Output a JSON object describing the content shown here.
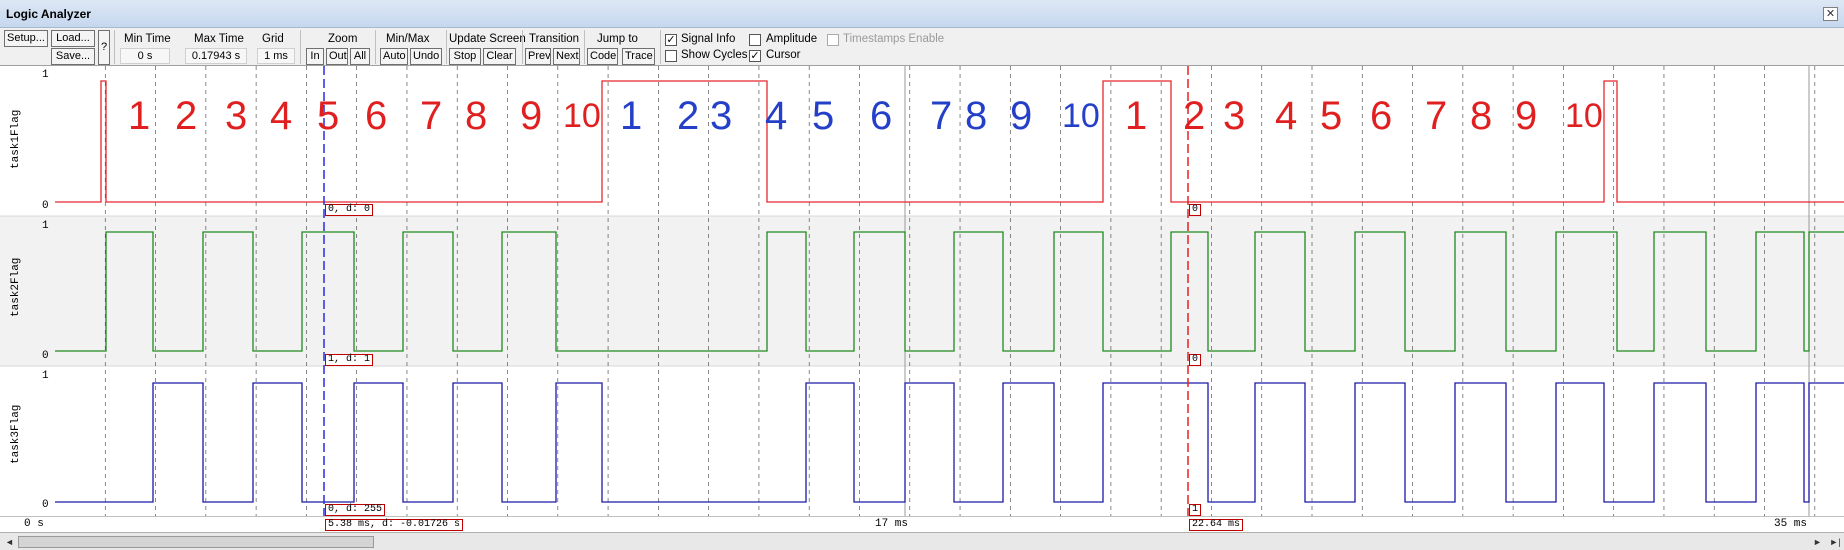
{
  "window": {
    "title": "Logic Analyzer",
    "close_glyph": "✕"
  },
  "toolbar": {
    "setup": "Setup...",
    "load": "Load...",
    "save": "Save...",
    "help": "?",
    "min_time_label": "Min Time",
    "min_time_value": "0 s",
    "max_time_label": "Max Time",
    "max_time_value": "0.17943 s",
    "grid_label": "Grid",
    "grid_value": "1 ms",
    "zoom_label": "Zoom",
    "zoom_in": "In",
    "zoom_out": "Out",
    "zoom_all": "All",
    "minmax_label": "Min/Max",
    "minmax_auto": "Auto",
    "minmax_undo": "Undo",
    "update_label": "Update Screen",
    "update_stop": "Stop",
    "update_clear": "Clear",
    "transition_label": "Transition",
    "transition_prev": "Prev",
    "transition_next": "Next",
    "jump_label": "Jump to",
    "jump_code": "Code",
    "jump_trace": "Trace",
    "signal_info": "Signal Info",
    "signal_info_checked": true,
    "show_cycles": "Show Cycles",
    "show_cycles_checked": false,
    "amplitude": "Amplitude",
    "amplitude_checked": false,
    "cursor": "Cursor",
    "cursor_checked": true,
    "timestamps": "Timestamps Enable",
    "timestamps_checked": false,
    "check_glyph": "✓"
  },
  "signals": [
    {
      "name": "task1Flag",
      "color": "#e8282d",
      "high": "1",
      "low": "0",
      "blue_info": "0,  d: 0",
      "red_info": "0"
    },
    {
      "name": "task2Flag",
      "color": "#1e8a1e",
      "high": "1",
      "low": "0",
      "blue_info": "1,  d: 1",
      "red_info": "0"
    },
    {
      "name": "task3Flag",
      "color": "#1a1aa8",
      "high": "1",
      "low": "0",
      "blue_info": "0,  d: 255",
      "red_info": "1"
    }
  ],
  "time_axis": {
    "start": "0 s",
    "mid": "17 ms",
    "end": "35 ms"
  },
  "cursors": {
    "blue": {
      "color": "#2a2ae0",
      "readout": "5.38 ms,  d: -0.01726 s"
    },
    "red": {
      "color": "#e82020",
      "readout": "22.64 ms"
    }
  },
  "annotations": {
    "red_a": [
      "1",
      "2",
      "3",
      "4",
      "5",
      "6",
      "7",
      "8",
      "9",
      "10"
    ],
    "blue": [
      "1",
      "2",
      "3",
      "4",
      "5",
      "6",
      "7",
      "8",
      "9",
      "10"
    ],
    "red_b": [
      "1",
      "2",
      "3",
      "4",
      "5",
      "6",
      "7",
      "8",
      "9",
      "10"
    ]
  },
  "scrollbar": {
    "left": "◄",
    "right": "►",
    "end": "►|"
  }
}
